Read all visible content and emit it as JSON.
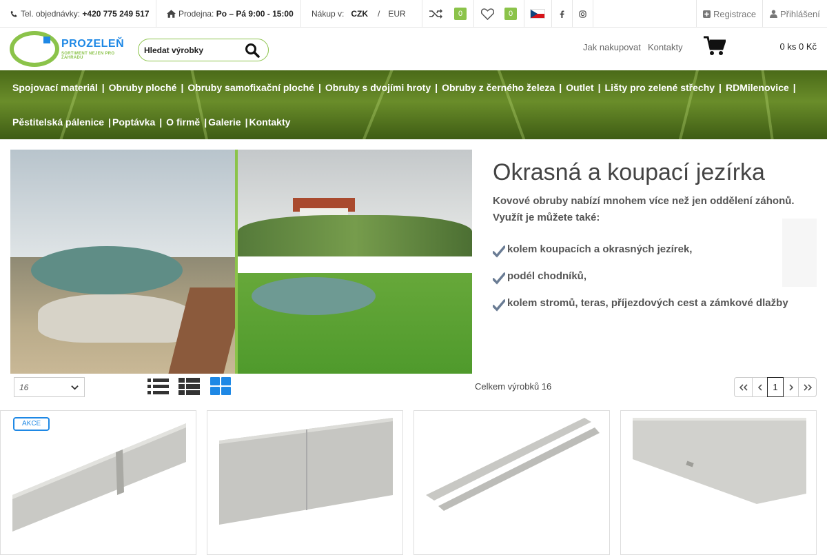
{
  "topbar": {
    "phone_label": "Tel. objednávky:",
    "phone": "+420 775 249 517",
    "store_label": "Prodejna:",
    "store_hours": "Po – Pá 9:00 - 15:00",
    "currency_label": "Nákup v:",
    "currency_active": "CZK",
    "currency_sep": "/",
    "currency_other": "EUR",
    "compare_count": "0",
    "wishlist_count": "0",
    "register": "Registrace",
    "login": "Přihlášení"
  },
  "header": {
    "logo_name": "PROZELEŇ",
    "logo_tagline": "SORTIMENT NEJEN PRO ZAHRADU",
    "search_placeholder": "Hledat výrobky",
    "links": [
      "Jak nakupovat",
      "Kontakty"
    ],
    "cart_summary": "0 ks 0 Kč"
  },
  "nav": {
    "row1": [
      "Spojovací materiál",
      "Obruby ploché",
      "Obruby samofixační ploché",
      "Obruby s dvojími hroty",
      "Obruby z černého železa",
      "Outlet",
      "Lišty pro zelené střechy",
      "RDMilenovice"
    ],
    "row2": [
      "Pěstitelská pálenice",
      "Poptávka",
      "O firmě",
      "Galerie",
      "Kontakty"
    ],
    "separator": "|"
  },
  "hero": {
    "title": "Okrasná a koupací jezírka",
    "lead": "Kovové obruby nabízí mnohem více než jen oddělení záhonů. Využít je můžete také:",
    "bullets": [
      "kolem koupacích a okrasných jezírek,",
      "podél chodníků,",
      "kolem stromů, teras, příjezdových cest a zámkové dlažby"
    ]
  },
  "toolbar": {
    "per_page": "16",
    "total_text": "Celkem výrobků 16",
    "current_page": "1"
  },
  "products": {
    "badge_sale": "AKCE"
  },
  "colors": {
    "accent_green": "#8bc34a",
    "brand_blue": "#1e88e5"
  }
}
